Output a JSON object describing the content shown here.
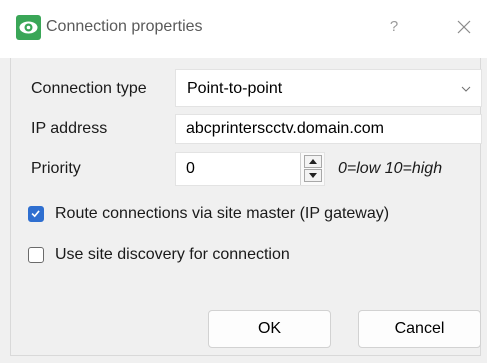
{
  "window": {
    "title": "Connection properties",
    "help_label": "?",
    "icon": "eye-icon",
    "accent_color": "#3aa657"
  },
  "form": {
    "connection_type": {
      "label": "Connection type",
      "value": "Point-to-point"
    },
    "ip_address": {
      "label": "IP address",
      "value": "abcprinterscctv.domain.com"
    },
    "priority": {
      "label": "Priority",
      "value": "0",
      "hint": "0=low 10=high"
    },
    "route_via_master": {
      "label": "Route connections via site master (IP gateway)",
      "checked": true
    },
    "site_discovery": {
      "label": "Use site discovery for connection",
      "checked": false
    }
  },
  "buttons": {
    "ok": "OK",
    "cancel": "Cancel"
  },
  "colors": {
    "checkbox_checked": "#2f6fd0",
    "dialog_background": "#f0f0f0"
  }
}
